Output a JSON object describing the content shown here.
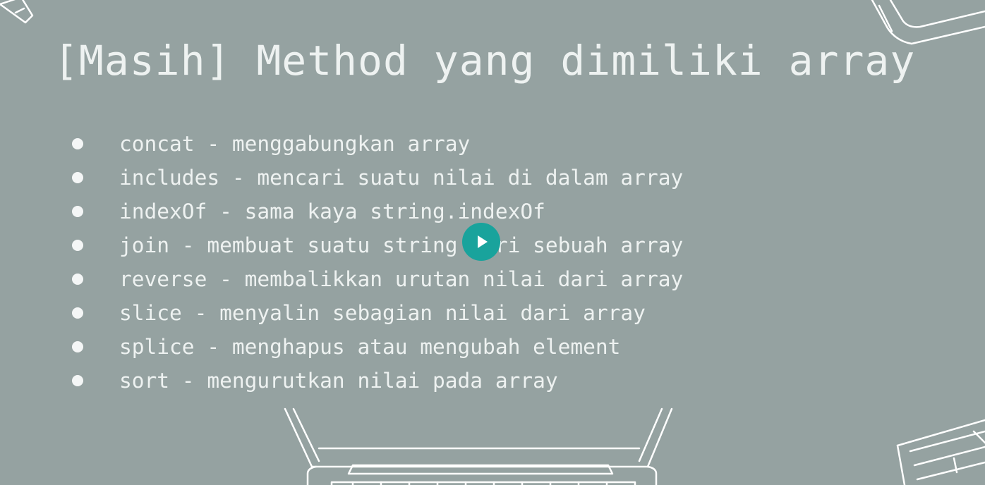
{
  "slide": {
    "title": "[Masih] Method yang dimiliki array",
    "items": [
      "concat - menggabungkan array",
      "includes - mencari suatu nilai di dalam array",
      "indexOf - sama kaya string.indexOf",
      "join - membuat suatu string dari sebuah array",
      "reverse - membalikkan urutan nilai dari array",
      "slice - menyalin sebagian nilai dari array",
      "splice - menghapus atau mengubah element",
      "sort - mengurutkan nilai pada array"
    ]
  },
  "player": {
    "play_icon": "play-icon",
    "accent_color": "#19a39c"
  },
  "colors": {
    "background": "#95a2a1",
    "text": "#eef2f1"
  },
  "decorations": [
    "pencil-sketch",
    "tablet-sketch",
    "laptop-sketch",
    "keyboard-sketch"
  ]
}
